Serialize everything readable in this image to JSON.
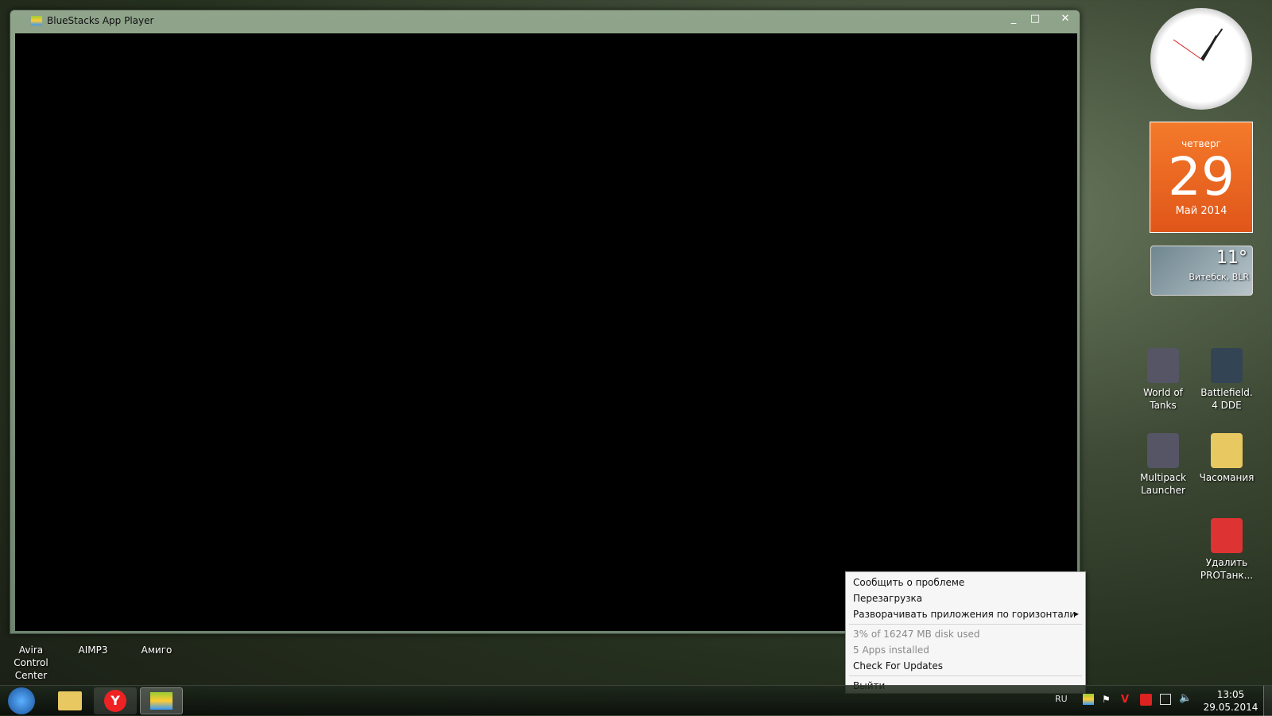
{
  "window": {
    "title": "BlueStacks App Player",
    "minimize": "_",
    "maximize": "□",
    "close": "✕"
  },
  "context_menu": {
    "items": [
      {
        "label": "Сообщить о проблеме",
        "enabled": true
      },
      {
        "label": "Перезагрузка",
        "enabled": true
      },
      {
        "label": "Разворачивать приложения по горизонтали",
        "enabled": true,
        "submenu": true
      },
      {
        "label": "3% of 16247 MB disk used",
        "enabled": false
      },
      {
        "label": "5 Apps installed",
        "enabled": false
      },
      {
        "label": "Check For Updates",
        "enabled": true
      },
      {
        "label": "Выйти",
        "enabled": true
      }
    ],
    "submenu_arrow": "▶"
  },
  "gadgets": {
    "calendar": {
      "weekday": "четверг",
      "day": "29",
      "month_year": "Май 2014"
    },
    "weather": {
      "temp": "11°",
      "location": "Витебск, BLR"
    }
  },
  "desktop_icons": {
    "right": [
      "World of Tanks",
      "Battlefield. 4 DDE",
      "Multipack Launcher",
      "Часомания",
      "Удалить PROТанк..."
    ],
    "bottom": [
      "Avira Control Center",
      "AIMP3",
      "Амиго"
    ]
  },
  "taskbar": {
    "language": "RU",
    "time": "13:05",
    "date": "29.05.2014"
  }
}
